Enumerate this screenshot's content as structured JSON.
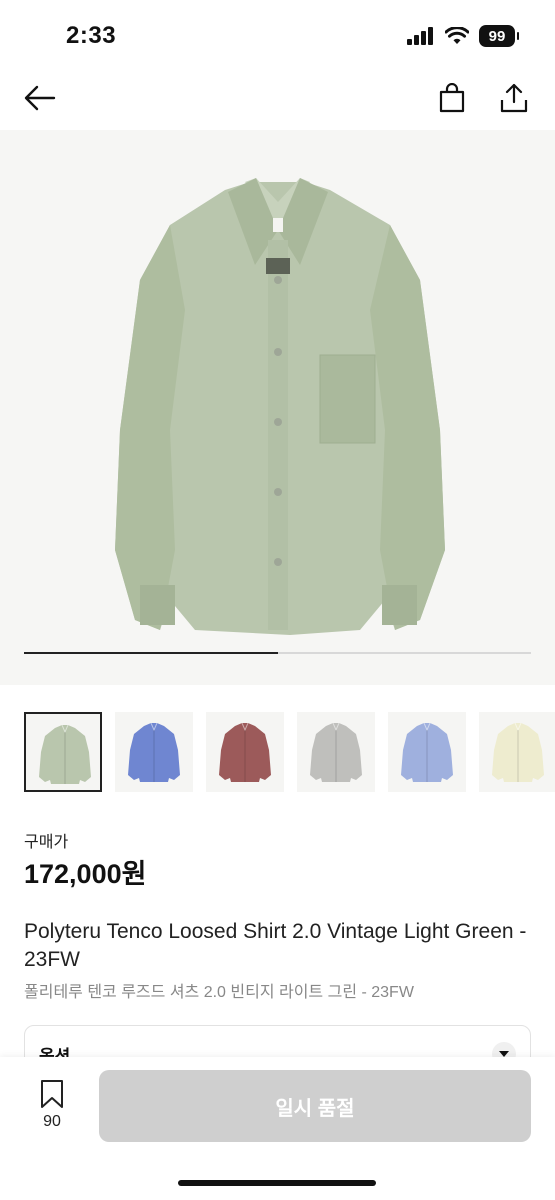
{
  "status_bar": {
    "time": "2:33",
    "battery": "99"
  },
  "header": {
    "icons": [
      "back-arrow-icon",
      "shopping-bag-icon",
      "share-icon"
    ]
  },
  "gallery": {
    "main_image": "light-green-shirt",
    "progress": 0.5,
    "thumbnails": [
      {
        "color": "#b9c6ad",
        "name": "Vintage Light Green",
        "selected": true
      },
      {
        "color": "#6f86d1",
        "name": "Blue",
        "selected": false
      },
      {
        "color": "#9c5a5a",
        "name": "Burgundy",
        "selected": false
      },
      {
        "color": "#bfbfbc",
        "name": "Gray",
        "selected": false
      },
      {
        "color": "#9fb0de",
        "name": "Light Blue",
        "selected": false
      },
      {
        "color": "#eeeccf",
        "name": "Cream",
        "selected": false
      }
    ]
  },
  "product": {
    "price_label": "구매가",
    "price": "172,000원",
    "title_en": "Polyteru Tenco Loosed Shirt 2.0 Vintage Light Green - 23FW",
    "title_ko": "폴리테루 텐코 루즈드 셔츠 2.0 빈티지 라이트 그린 - 23FW"
  },
  "options": {
    "label": "옵션"
  },
  "bottom_bar": {
    "wish_count": "90",
    "buy_label": "일시 품절"
  },
  "colors": {
    "accent": "#111111",
    "disabled_button": "#cfcfcf"
  }
}
